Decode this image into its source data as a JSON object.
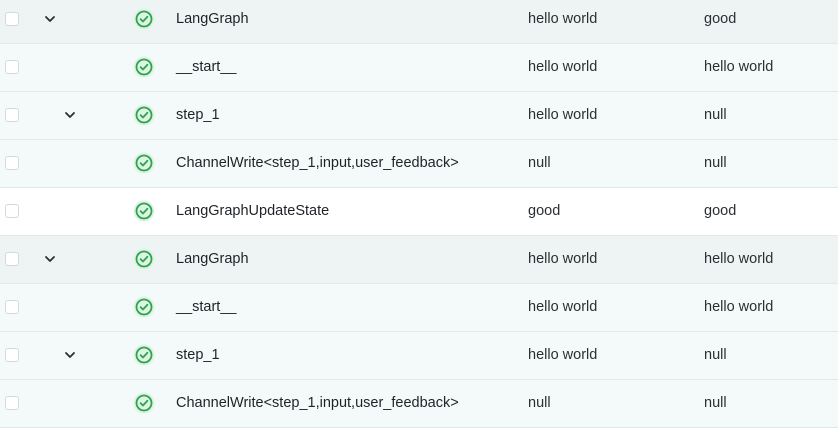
{
  "rows": [
    {
      "name": "LangGraph",
      "input": "hello world",
      "output": "good",
      "style": "top",
      "chevron": "level0"
    },
    {
      "name": "__start__",
      "input": "hello world",
      "output": "hello world",
      "style": "child",
      "chevron": "none"
    },
    {
      "name": "step_1",
      "input": "hello world",
      "output": "null",
      "style": "child",
      "chevron": "level1"
    },
    {
      "name": "ChannelWrite<step_1,input,user_feedback>",
      "input": "null",
      "output": "null",
      "style": "child",
      "chevron": "none"
    },
    {
      "name": "LangGraphUpdateState",
      "input": "good",
      "output": "good",
      "style": "plain",
      "chevron": "none"
    },
    {
      "name": "LangGraph",
      "input": "hello world",
      "output": "hello world",
      "style": "top",
      "chevron": "level0"
    },
    {
      "name": "__start__",
      "input": "hello world",
      "output": "hello world",
      "style": "child",
      "chevron": "none"
    },
    {
      "name": "step_1",
      "input": "hello world",
      "output": "null",
      "style": "child",
      "chevron": "level1"
    },
    {
      "name": "ChannelWrite<step_1,input,user_feedback>",
      "input": "null",
      "output": "null",
      "style": "child",
      "chevron": "none"
    }
  ],
  "icons": {
    "status": "check-circle-icon",
    "expand": "chevron-down-icon"
  },
  "colors": {
    "success_green": "#2da44e",
    "success_bg": "#dff3e4"
  }
}
